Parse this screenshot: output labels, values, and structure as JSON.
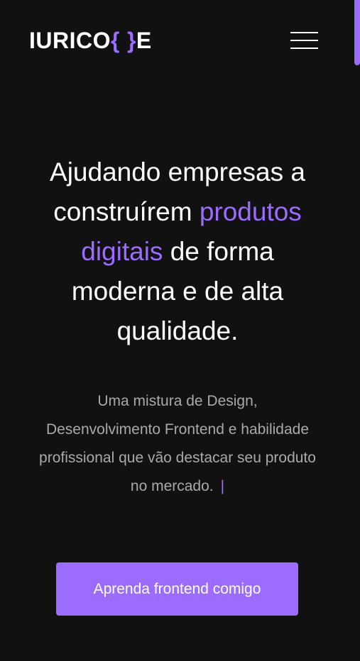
{
  "header": {
    "logo": {
      "part1": "IURICO",
      "brace_open": "{",
      "brace_close": "}",
      "part2": "E"
    },
    "menu_icon": "hamburger-menu-icon"
  },
  "hero": {
    "title_line1": "Ajudando empresas a",
    "title_line2_plain": "construírem ",
    "title_line2_accent": "produtos",
    "title_line3_accent": "digitais",
    "title_line3_plain": " de forma",
    "title_line4": "moderna e de alta",
    "title_line5": "qualidade.",
    "subtitle_line1": "Uma mistura de Design,",
    "subtitle_line2": "Desenvolvimento Frontend e habilidade",
    "subtitle_line3": "profissional que vão destacar seu produto",
    "subtitle_line4": "no mercado.",
    "typing_caret": "|",
    "cta_label": "Aprenda frontend comigo"
  },
  "colors": {
    "background": "#111112",
    "accent": "#9b6cff",
    "text": "#ffffff",
    "muted_text": "#a9a9ad"
  }
}
